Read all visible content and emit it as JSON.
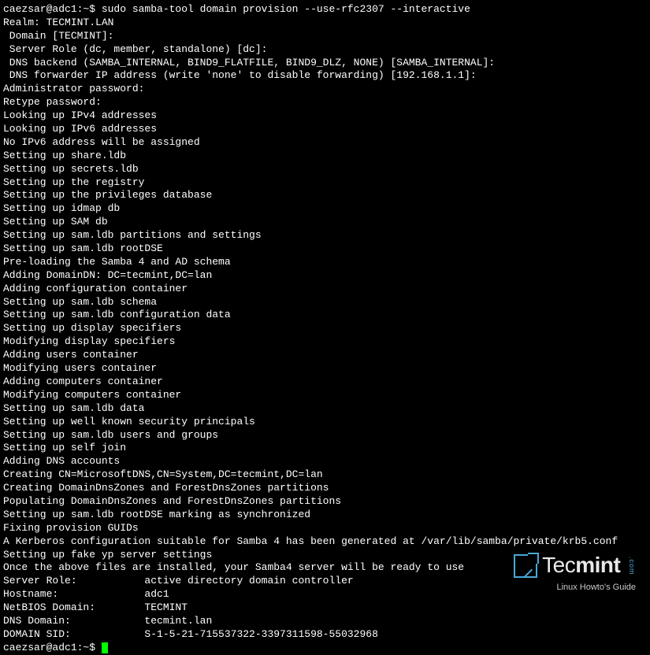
{
  "prompt1": "caezsar@adc1:~$ ",
  "command": "sudo samba-tool domain provision --use-rfc2307 --interactive",
  "lines": [
    "Realm: TECMINT.LAN",
    " Domain [TECMINT]:",
    " Server Role (dc, member, standalone) [dc]:",
    " DNS backend (SAMBA_INTERNAL, BIND9_FLATFILE, BIND9_DLZ, NONE) [SAMBA_INTERNAL]:",
    " DNS forwarder IP address (write 'none' to disable forwarding) [192.168.1.1]:",
    "Administrator password:",
    "Retype password:",
    "Looking up IPv4 addresses",
    "Looking up IPv6 addresses",
    "No IPv6 address will be assigned",
    "Setting up share.ldb",
    "Setting up secrets.ldb",
    "Setting up the registry",
    "Setting up the privileges database",
    "Setting up idmap db",
    "Setting up SAM db",
    "Setting up sam.ldb partitions and settings",
    "Setting up sam.ldb rootDSE",
    "Pre-loading the Samba 4 and AD schema",
    "Adding DomainDN: DC=tecmint,DC=lan",
    "Adding configuration container",
    "Setting up sam.ldb schema",
    "Setting up sam.ldb configuration data",
    "Setting up display specifiers",
    "Modifying display specifiers",
    "Adding users container",
    "Modifying users container",
    "Adding computers container",
    "Modifying computers container",
    "Setting up sam.ldb data",
    "Setting up well known security principals",
    "Setting up sam.ldb users and groups",
    "Setting up self join",
    "Adding DNS accounts",
    "Creating CN=MicrosoftDNS,CN=System,DC=tecmint,DC=lan",
    "Creating DomainDnsZones and ForestDnsZones partitions",
    "Populating DomainDnsZones and ForestDnsZones partitions",
    "Setting up sam.ldb rootDSE marking as synchronized",
    "Fixing provision GUIDs",
    "A Kerberos configuration suitable for Samba 4 has been generated at /var/lib/samba/private/krb5.conf",
    "Setting up fake yp server settings",
    "Once the above files are installed, your Samba4 server will be ready to use",
    "Server Role:           active directory domain controller",
    "Hostname:              adc1",
    "NetBIOS Domain:        TECMINT",
    "DNS Domain:            tecmint.lan",
    "DOMAIN SID:            S-1-5-21-715537322-3397311598-55032968"
  ],
  "prompt2": "caezsar@adc1:~$ ",
  "watermark": {
    "brand_light": "Tec",
    "brand_bold": "mint",
    "com": ".com",
    "tagline": "Linux Howto's Guide"
  }
}
